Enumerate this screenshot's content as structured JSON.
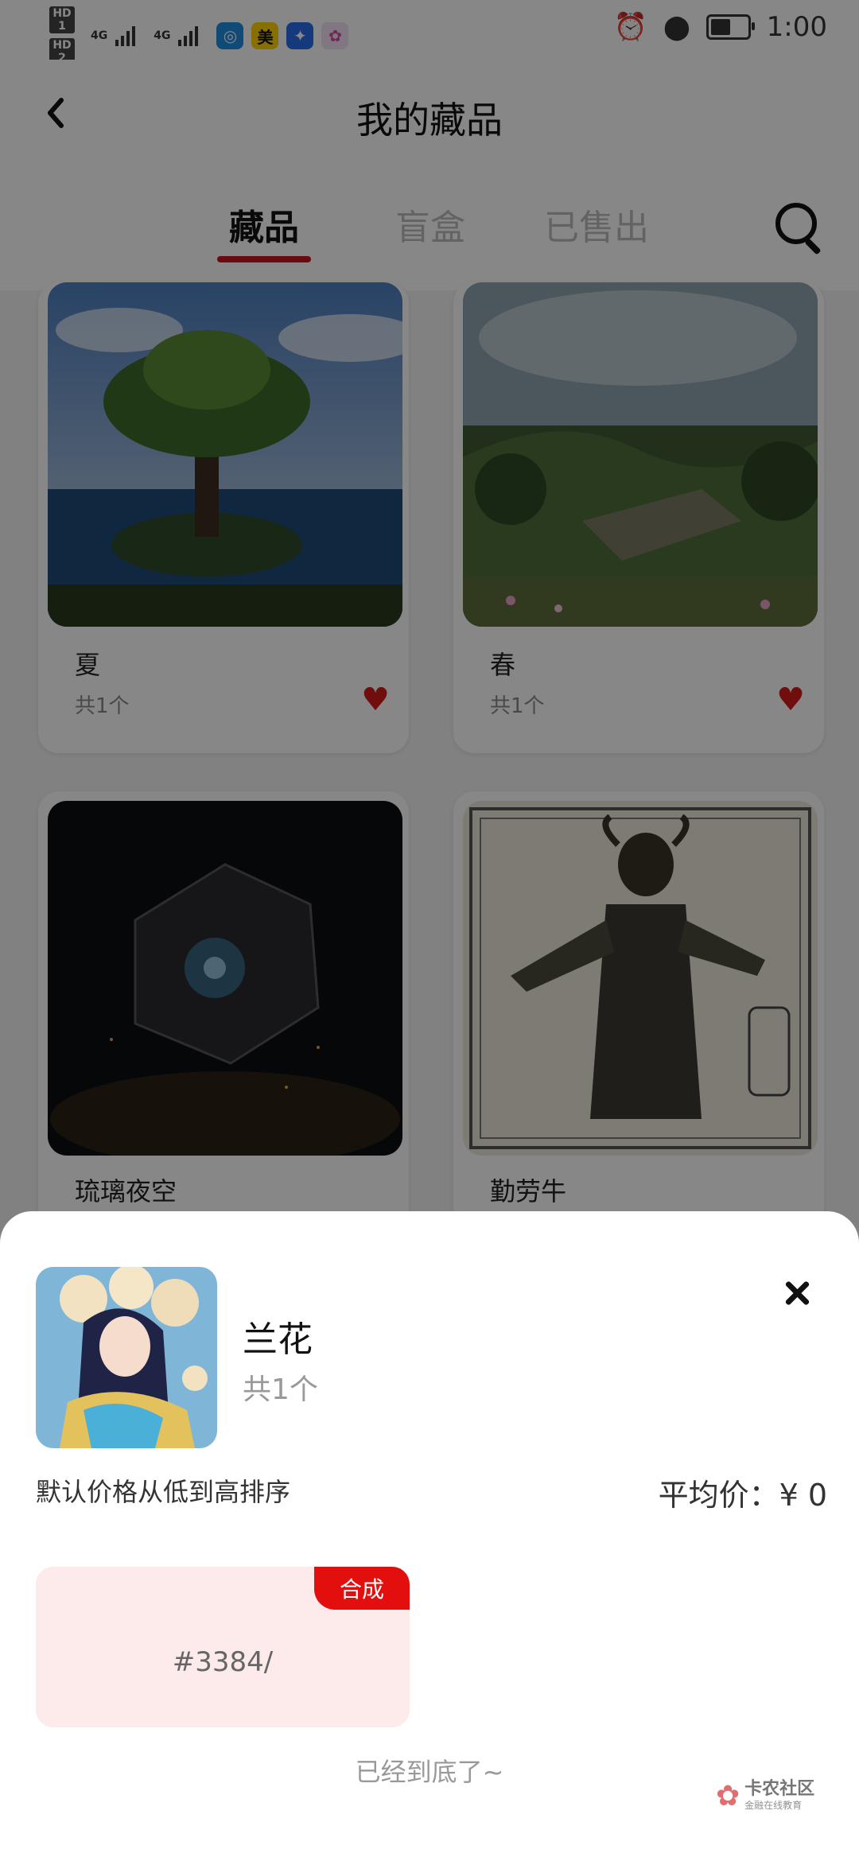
{
  "status_bar": {
    "hd1": "HD 1",
    "hd2": "HD 2",
    "signal1": "4G",
    "signal2": "4G",
    "app3_label": "美",
    "time": "1:00"
  },
  "header": {
    "back_icon": "chevron-left-icon",
    "title": "我的藏品",
    "tabs": [
      {
        "label": "藏品",
        "active": true
      },
      {
        "label": "盲盒",
        "active": false
      },
      {
        "label": "已售出",
        "active": false
      }
    ],
    "search_icon": "search-icon"
  },
  "collection": [
    {
      "name": "夏",
      "count": "共1个"
    },
    {
      "name": "春",
      "count": "共1个"
    },
    {
      "name": "琉璃夜空",
      "count": ""
    },
    {
      "name": "勤劳牛",
      "count": ""
    }
  ],
  "sheet": {
    "name": "兰花",
    "count": "共1个",
    "sort_label": "默认价格从低到高排序",
    "avg_price": "平均价：¥ 0",
    "item": {
      "badge": "合成",
      "id": "#3384/"
    },
    "end_text": "已经到底了~",
    "watermark_title": "卡农社区",
    "watermark_sub": "金融在线教育"
  },
  "colors": {
    "accent": "#c8141c",
    "badge": "#e30e0e",
    "item_bg": "#fdeaea"
  }
}
